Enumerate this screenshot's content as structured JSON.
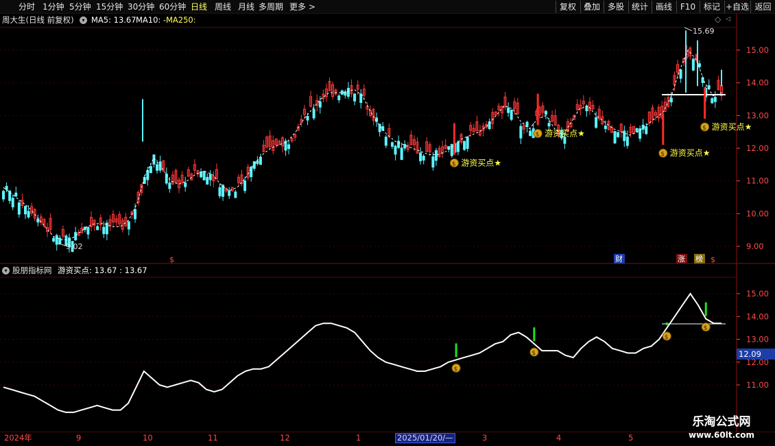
{
  "toolbar": {
    "periods": [
      "分时",
      "1分钟",
      "5分钟",
      "15分钟",
      "30分钟",
      "60分钟",
      "日线",
      "周线",
      "月线",
      "多周期",
      "更多 >"
    ],
    "active_period": "日线",
    "right_buttons": [
      "复权",
      "叠加",
      "多股",
      "统计",
      "画线",
      "F10",
      "标记",
      "+自选",
      "返回"
    ]
  },
  "main_header": {
    "stock": "周大生(日线 前复权)",
    "ma5": "MA5: 13.67",
    "ma10": "MA10: -",
    "ma250": "MA250:"
  },
  "sub_header": {
    "source": "股朋指标网",
    "indicator": "游资买点: 13.67 : 13.67"
  },
  "signal_label": "游资买点★",
  "price_badge": "12.09",
  "events": {
    "cai": "财",
    "zhang": "涨",
    "bang": "榜",
    "dollar": "$"
  },
  "watermark": {
    "line1": "乐淘公式网",
    "line2": "www.60lt.com"
  },
  "annotations": {
    "high": "15.69",
    "low": "9.02"
  },
  "dates": {
    "labels": [
      "2024年",
      "9",
      "10",
      "11",
      "12",
      "1",
      "3",
      "4",
      "5"
    ],
    "cursor": "2025/01/20/—"
  },
  "colors": {
    "up": "#ff3a3a",
    "down": "#5cf4ff",
    "ma": "#ffffff",
    "signal": "#ffff4d",
    "bar": "#22e022",
    "axis": "#ff4a4a"
  },
  "chart_data": [
    {
      "type": "candlestick",
      "title": "周大生(日线 前复权)",
      "y_ticks": [
        9.0,
        10.0,
        11.0,
        12.0,
        13.0,
        14.0,
        15.0
      ],
      "ylim": [
        8.5,
        16.2
      ],
      "high": 15.69,
      "low": 9.02,
      "ma_line": [
        10.8,
        10.6,
        10.4,
        10.2,
        9.9,
        9.6,
        9.3,
        9.2,
        9.2,
        9.4,
        9.6,
        9.7,
        9.7,
        9.6,
        9.6,
        9.8,
        10.3,
        11.2,
        11.7,
        11.4,
        11.0,
        10.9,
        11.0,
        11.2,
        11.3,
        11.2,
        10.9,
        10.7,
        10.8,
        11.1,
        11.5,
        11.8,
        12.0,
        12.1,
        12.2,
        12.5,
        12.9,
        13.2,
        13.5,
        13.7,
        13.7,
        13.7,
        13.8,
        13.6,
        13.1,
        12.7,
        12.4,
        12.2,
        12.1,
        12.0,
        11.9,
        11.8,
        11.8,
        11.9,
        12.1,
        12.3,
        12.4,
        12.5,
        12.7,
        13.0,
        13.3,
        13.2,
        12.8,
        12.6,
        12.9,
        13.0,
        12.6,
        12.4,
        12.8,
        13.2,
        13.3,
        13.0,
        12.8,
        12.6,
        12.5,
        12.4,
        12.5,
        12.7,
        12.9,
        13.1,
        13.6,
        14.4,
        15.0,
        14.7,
        14.0,
        13.6,
        13.7
      ],
      "signals": [
        {
          "x_index": 54,
          "price": 11.55
        },
        {
          "x_index": 64,
          "price": 12.45
        },
        {
          "x_index": 79,
          "price": 11.85
        },
        {
          "x_index": 84,
          "price": 12.65
        }
      ]
    },
    {
      "type": "line",
      "title": "游资买点",
      "y_ticks": [
        11.0,
        12.0,
        13.0,
        14.0,
        15.0
      ],
      "ylim": [
        10.0,
        16.0
      ],
      "last_value": 13.67,
      "marker": 12.09,
      "values": [
        10.9,
        10.8,
        10.7,
        10.6,
        10.5,
        10.3,
        10.1,
        9.9,
        9.8,
        9.8,
        9.9,
        10.0,
        10.1,
        10.0,
        9.9,
        9.9,
        10.2,
        10.9,
        11.6,
        11.3,
        11.0,
        10.9,
        11.0,
        11.1,
        11.2,
        11.1,
        10.8,
        10.7,
        10.8,
        11.1,
        11.4,
        11.6,
        11.7,
        11.7,
        11.8,
        12.1,
        12.4,
        12.7,
        13.0,
        13.3,
        13.6,
        13.7,
        13.7,
        13.6,
        13.5,
        13.3,
        12.9,
        12.5,
        12.2,
        12.0,
        11.9,
        11.8,
        11.7,
        11.6,
        11.6,
        11.7,
        11.8,
        12.0,
        12.1,
        12.2,
        12.3,
        12.4,
        12.6,
        12.8,
        12.9,
        13.2,
        13.3,
        13.1,
        12.8,
        12.5,
        12.5,
        12.5,
        12.3,
        12.2,
        12.6,
        12.9,
        13.1,
        12.9,
        12.6,
        12.5,
        12.4,
        12.4,
        12.6,
        12.7,
        13.0,
        13.5,
        14.0,
        14.5,
        15.0,
        14.5,
        13.9,
        13.7,
        13.7
      ]
    }
  ]
}
